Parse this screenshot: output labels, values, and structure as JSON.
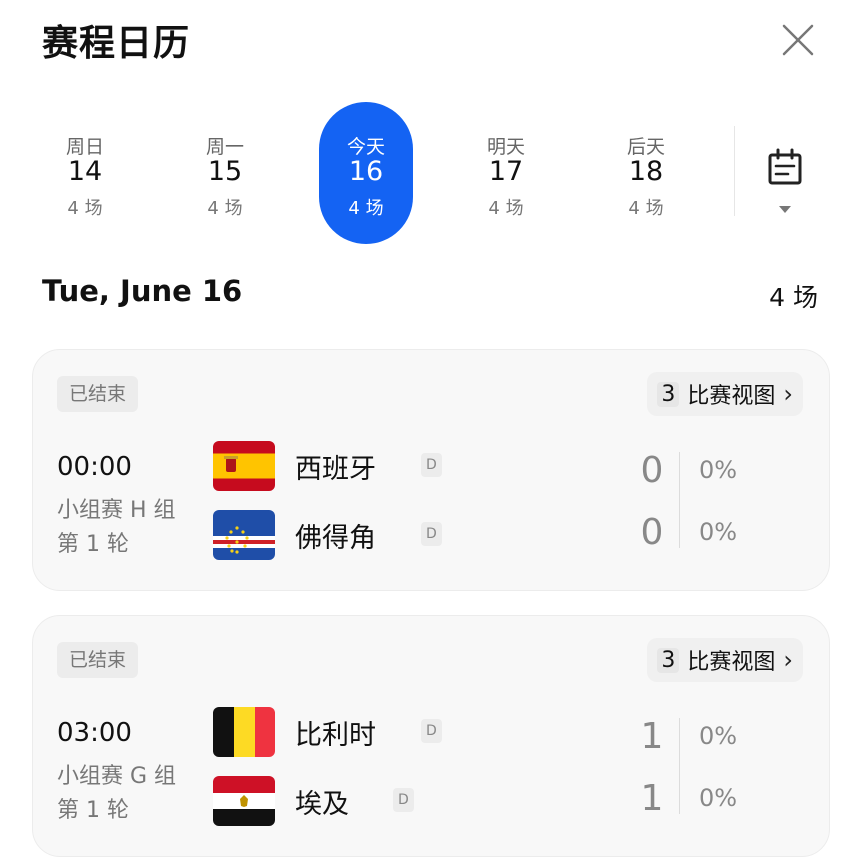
{
  "header": {
    "title": "赛程日历"
  },
  "dates": [
    {
      "weekday": "周日",
      "day": "14",
      "count": "4 场",
      "active": false
    },
    {
      "weekday": "周一",
      "day": "15",
      "count": "4 场",
      "active": false
    },
    {
      "weekday": "今天",
      "day": "16",
      "count": "4 场",
      "active": true
    },
    {
      "weekday": "明天",
      "day": "17",
      "count": "4 场",
      "active": false
    },
    {
      "weekday": "后天",
      "day": "18",
      "count": "4 场",
      "active": false
    }
  ],
  "day_heading": {
    "date": "Tue, June 16",
    "count": "4 场"
  },
  "matches": [
    {
      "status": "已结束",
      "view_count": "3",
      "view_label": "比赛视图",
      "time": "00:00",
      "stage": "小组赛 H 组",
      "round": "第 1 轮",
      "teams": [
        {
          "name": "西班牙",
          "tag": "D",
          "score": "0",
          "percent": "0%",
          "flag": "spain"
        },
        {
          "name": "佛得角",
          "tag": "D",
          "score": "0",
          "percent": "0%",
          "flag": "cape-verde"
        }
      ]
    },
    {
      "status": "已结束",
      "view_count": "3",
      "view_label": "比赛视图",
      "time": "03:00",
      "stage": "小组赛 G 组",
      "round": "第 1 轮",
      "teams": [
        {
          "name": "比利时",
          "tag": "D",
          "score": "1",
          "percent": "0%",
          "flag": "belgium"
        },
        {
          "name": "埃及",
          "tag": "D",
          "score": "1",
          "percent": "0%",
          "flag": "egypt"
        }
      ]
    }
  ],
  "colors": {
    "accent": "#1463f3",
    "card_bg": "#f8f8f8",
    "muted_text": "#777777"
  },
  "icons": {
    "close": "close-icon",
    "calendar": "calendar-icon",
    "dropdown": "caret-down-icon",
    "chevron": "chevron-right-icon"
  }
}
